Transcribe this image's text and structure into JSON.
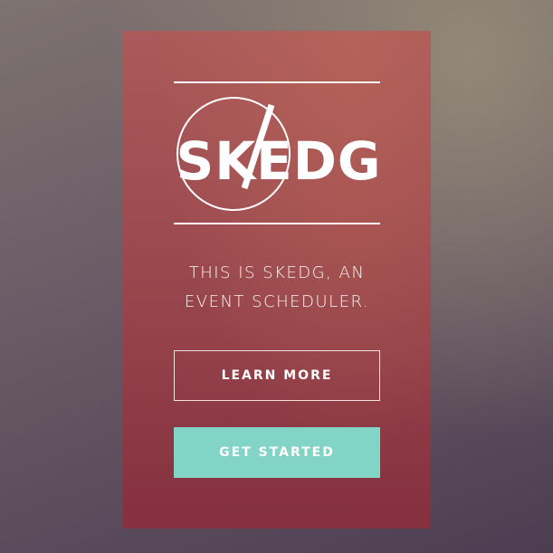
{
  "logo": {
    "text": "SKEDG",
    "icon": "no-symbol-circle"
  },
  "tagline": {
    "line1": "THIS IS SKEDG, AN",
    "line2": "EVENT SCHEDULER."
  },
  "buttons": {
    "learn_more": "LEARN MORE",
    "get_started": "GET STARTED"
  },
  "colors": {
    "card_top": "#ab5a5a",
    "card_bottom": "#852f3f",
    "accent_button": "#82d4c7",
    "text": "#ffffff"
  }
}
